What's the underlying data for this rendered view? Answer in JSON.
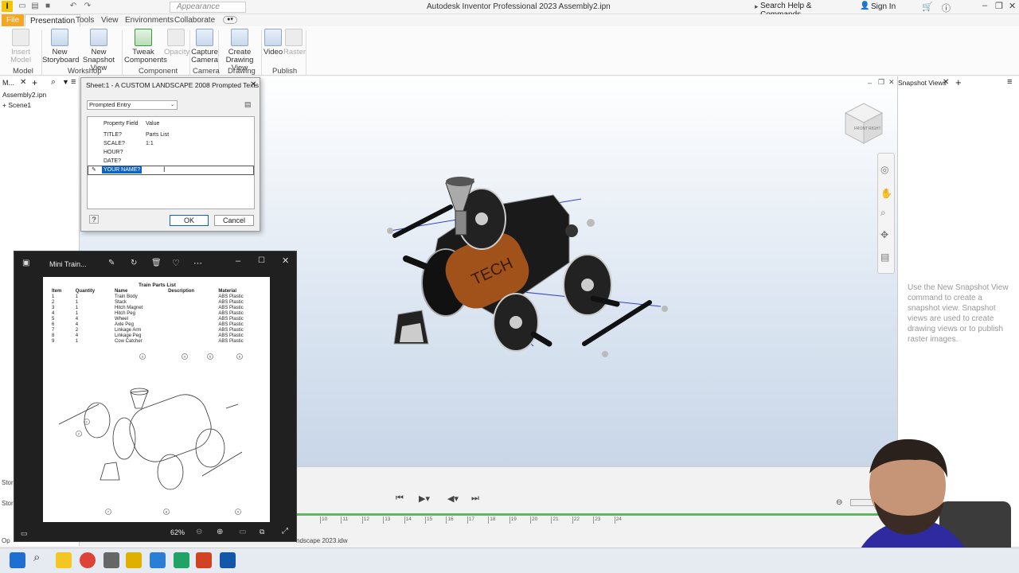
{
  "app": {
    "title": "Autodesk Inventor Professional 2023 Assembly2.ipn",
    "appearance_placeholder": "Appearance",
    "search": "Search Help & Commands...",
    "sign_in": "Sign In"
  },
  "tabs": [
    "File",
    "Presentation",
    "Tools",
    "View",
    "Environments",
    "Collaborate"
  ],
  "ribbon": {
    "buttons": [
      {
        "label": "Insert Model",
        "enabled": false
      },
      {
        "label": "New Storyboard",
        "enabled": true
      },
      {
        "label": "New Snapshot View",
        "enabled": true
      },
      {
        "label": "Tweak Components",
        "enabled": true
      },
      {
        "label": "Opacity",
        "enabled": false
      },
      {
        "label": "Capture Camera",
        "enabled": true
      },
      {
        "label": "Create Drawing View",
        "enabled": true
      },
      {
        "label": "Video",
        "enabled": true
      },
      {
        "label": "Raster",
        "enabled": false
      }
    ],
    "groups": [
      "Model",
      "Workshop",
      "Component",
      "Camera",
      "Drawing",
      "Publish"
    ]
  },
  "browser": {
    "tab_label": "M...",
    "items": [
      "Assembly2.ipn",
      "Scene1"
    ],
    "story_label_1": "Stor",
    "story_label_2": "Stor",
    "status": "Op"
  },
  "dialog": {
    "title": "Sheet:1 - A CUSTOM LANDSCAPE 2008 Prompted Texts",
    "dropdown": "Prompted Entry",
    "columns": [
      "Property Field",
      "Value"
    ],
    "rows": [
      {
        "field": "TITLE?",
        "value": "Parts List"
      },
      {
        "field": "SCALE?",
        "value": "1:1"
      },
      {
        "field": "HOUR?",
        "value": ""
      },
      {
        "field": "DATE?",
        "value": ""
      },
      {
        "field": "YOUR NAME?",
        "value": ""
      }
    ],
    "ok": "OK",
    "cancel": "Cancel"
  },
  "snapshot_panel": {
    "tab": "Snapshot Views",
    "hint": "Use the New Snapshot View command to create a snapshot view. Snapshot views are used to create drawing views or to publish raster images."
  },
  "viewcube": {
    "front": "FRONT",
    "right": "RIGHT"
  },
  "model_text": "TECH",
  "photos": {
    "title": "Mini Train...",
    "zoom": "62%",
    "sheet_title": "Train Parts List",
    "columns": [
      "Item",
      "Quantity",
      "Name",
      "Description",
      "Material"
    ],
    "parts": [
      [
        "1",
        "1",
        "Train Body",
        "",
        "ABS Plastic"
      ],
      [
        "2",
        "1",
        "Stack",
        "",
        "ABS Plastic"
      ],
      [
        "3",
        "1",
        "Hitch Magnet",
        "",
        "ABS Plastic"
      ],
      [
        "4",
        "1",
        "Hitch Peg",
        "",
        "ABS Plastic"
      ],
      [
        "5",
        "4",
        "Wheel",
        "",
        "ABS Plastic"
      ],
      [
        "6",
        "4",
        "Axle Peg",
        "",
        "ABS Plastic"
      ],
      [
        "7",
        "2",
        "Linkage Arm",
        "",
        "ABS Plastic"
      ],
      [
        "8",
        "4",
        "Linkage Peg",
        "",
        "ABS Plastic"
      ],
      [
        "9",
        "1",
        "Cow Catcher",
        "",
        "ABS Plastic"
      ]
    ],
    "balloons": [
      "3",
      "4",
      "5",
      "6",
      "1",
      "2",
      "7",
      "8",
      "9"
    ]
  },
  "timeline": {
    "ticks": [
      "10",
      "11",
      "12",
      "13",
      "14",
      "15",
      "16",
      "17",
      "18",
      "19",
      "20",
      "21",
      "22",
      "23",
      "24"
    ],
    "file_tab": "ndscape 2023.idw"
  }
}
